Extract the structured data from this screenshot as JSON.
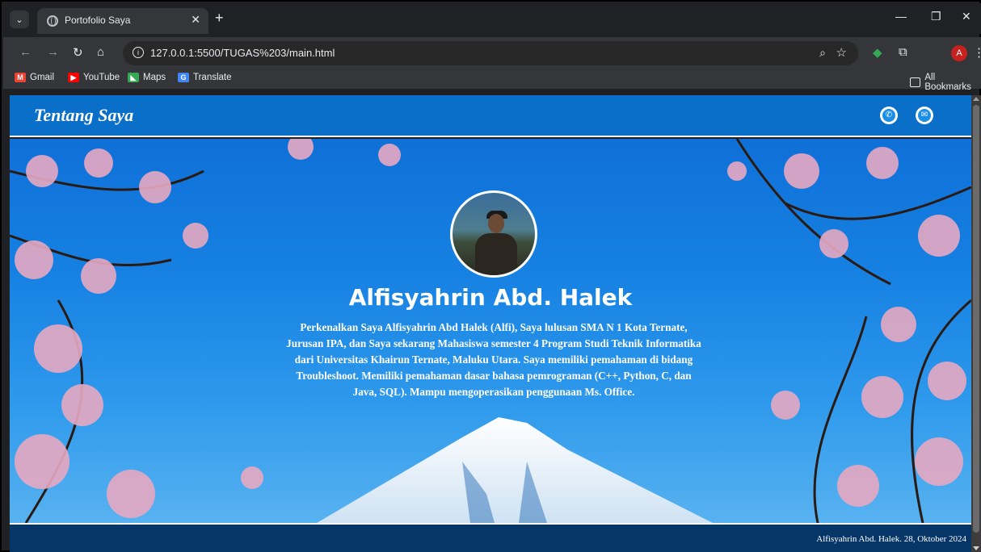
{
  "browser": {
    "tab_title": "Portofolio Saya",
    "url": "127.0.0.1:5500/TUGAS%203/main.html",
    "profile_initial": "A",
    "bookmarks": [
      {
        "label": "Gmail",
        "icon": "gmail-icon",
        "color": "#ea4335"
      },
      {
        "label": "YouTube",
        "icon": "youtube-icon",
        "color": "#ff0000"
      },
      {
        "label": "Maps",
        "icon": "maps-icon",
        "color": "#34a853"
      },
      {
        "label": "Translate",
        "icon": "translate-icon",
        "color": "#4285f4"
      }
    ],
    "all_bookmarks_label": "All Bookmarks"
  },
  "site": {
    "header_title": "Tentang Saya",
    "contact_icons": [
      "phone-icon",
      "email-icon"
    ],
    "name": "Alfisyahrin Abd. Halek",
    "description": "Perkenalkan Saya Alfisyahrin Abd Halek (Alfi), Saya lulusan SMA N 1 Kota Ternate, Jurusan IPA, dan Saya sekarang Mahasiswa semester 4 Program Studi Teknik Informatika dari Universitas Khairun Ternate, Maluku Utara. Saya memiliki pemahaman di bidang Troubleshoot. Memiliki pemahaman dasar bahasa pemrograman (C++, Python, C, dan Java, SQL). Mampu mengoperasikan penggunaan Ms. Office.",
    "footer": "Alfisyahrin Abd. Halek. 28, Oktober 2024",
    "colors": {
      "header_bg": "#0a6fc9",
      "footer_bg": "#063567",
      "sky": "#1681e2"
    }
  }
}
